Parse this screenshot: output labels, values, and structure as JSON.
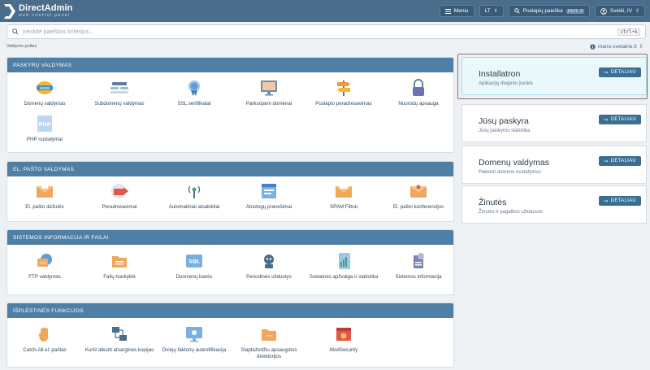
{
  "header": {
    "logo_name": "DirectAdmin",
    "logo_sub": "web control panel",
    "menu_label": "Meniu",
    "lang_label": "LT",
    "search_label": "Puslapių paieška",
    "search_kbd": "Ctrl J",
    "user_label": "Sveiki, IV"
  },
  "search": {
    "placeholder": "Įveskite paieškos kriterijus...",
    "shortcut": "ctrl+k"
  },
  "breadcrumb": "Valdymo pultas",
  "domain_selector": "mano-svetaine.lt",
  "sections": [
    {
      "title": "PASKYRŲ VALDYMAS",
      "items": [
        "Domenų valdymas",
        "Subdomenų valdymas",
        "SSL sertifikatai",
        "Parkuojami domenai",
        "Puslapio peradresavimas",
        "Nuorodų apsauga",
        "PHP nustatymai"
      ]
    },
    {
      "title": "EL. PAŠTO VALDYMAS",
      "items": [
        "El. pašto dėžutės",
        "Peradresavimai",
        "Automatiniai atsakikliai",
        "Atostogų pranešimai",
        "SPAM Filtrai",
        "El. pašto konferencijos"
      ]
    },
    {
      "title": "SISTEMOS INFORMACIJA IR FAILAI",
      "items": [
        "FTP valdymas",
        "Failų tvarkyklė",
        "Duomenų bazės",
        "Periodinės užduotys",
        "Svetainės apžvalga ir statistika",
        "Sistemos informacija"
      ]
    },
    {
      "title": "IŠPLĖSTINĖS FUNKCIJOS",
      "items": [
        "Catch-All el. paštas",
        "Kurti/ atkurti atsargines kopijas",
        "Dviejų faktorių autentifikacija",
        "Slaptažodžiu apsaugotos direktorijos",
        "ModSecurity"
      ]
    }
  ],
  "cards": [
    {
      "title": "Installatron",
      "desc": "Aplikacijų diegimo įrankis",
      "button": "DETALIAU"
    },
    {
      "title": "Jūsų paskyra",
      "desc": "Jūsų paskyros statistika",
      "button": "DETALIAU"
    },
    {
      "title": "Domenų valdymas",
      "desc": "Pakeisti domeno nustatymus",
      "button": "DETALIAU"
    },
    {
      "title": "Žinutės",
      "desc": "Žinutės ir pagalbos užklausos",
      "button": "DETALIAU"
    }
  ],
  "colors": {
    "topbar": "#4a6d8c",
    "section_header": "#4f7fa4",
    "button": "#3a6f93",
    "highlight_card": "#eaf8fb"
  }
}
